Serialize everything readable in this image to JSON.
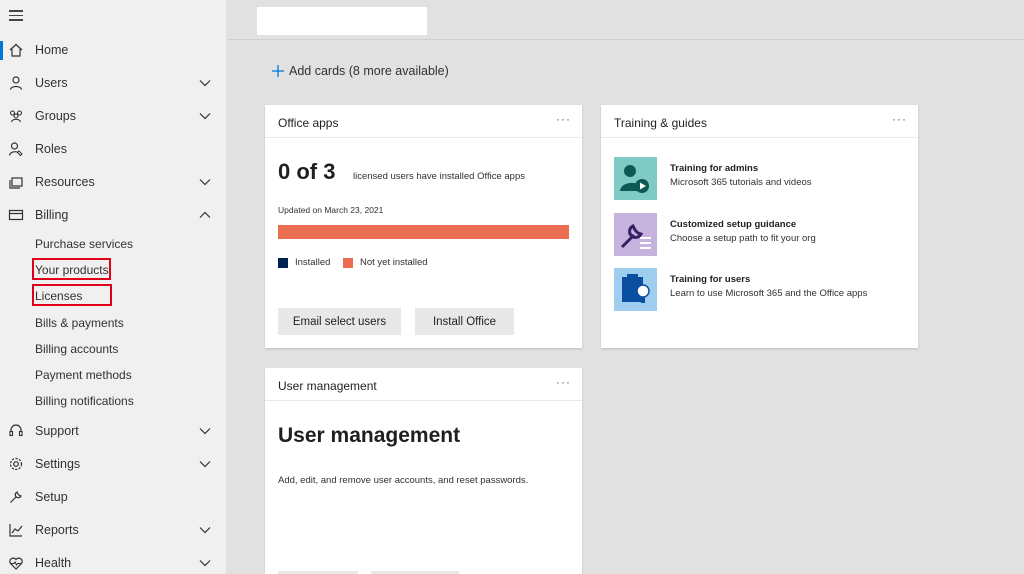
{
  "sidebar": {
    "menu_icon": "hamburger-icon",
    "items": [
      {
        "label": "Home",
        "icon": "home-icon",
        "expanded": null
      },
      {
        "label": "Users",
        "icon": "person-icon",
        "expanded": false
      },
      {
        "label": "Groups",
        "icon": "groups-icon",
        "expanded": false
      },
      {
        "label": "Roles",
        "icon": "roles-icon",
        "expanded": null
      },
      {
        "label": "Resources",
        "icon": "resources-icon",
        "expanded": false
      },
      {
        "label": "Billing",
        "icon": "billing-icon",
        "expanded": true
      },
      {
        "label": "Support",
        "icon": "headset-icon",
        "expanded": false
      },
      {
        "label": "Settings",
        "icon": "gear-icon",
        "expanded": false
      },
      {
        "label": "Setup",
        "icon": "wrench-icon",
        "expanded": null
      },
      {
        "label": "Reports",
        "icon": "chart-icon",
        "expanded": false
      },
      {
        "label": "Health",
        "icon": "heart-icon",
        "expanded": false
      }
    ],
    "billing_sub": [
      "Purchase services",
      "Your products",
      "Licenses",
      "Bills & payments",
      "Billing accounts",
      "Payment methods",
      "Billing notifications"
    ],
    "highlighted_sub": [
      "Your products",
      "Licenses"
    ],
    "active": "Home"
  },
  "main": {
    "add_cards_label": "Add cards (8 more available)",
    "colors": {
      "accent": "#0078d4",
      "highlight": "#e0001b",
      "installed": "#002050",
      "not_installed": "#eb6e52"
    },
    "office_apps": {
      "title": "Office apps",
      "more": "···",
      "stat": "0 of 3",
      "stat_desc": "licensed users have installed Office apps",
      "updated": "Updated on March 23, 2021",
      "installed_fraction": 0,
      "legend_installed": "Installed",
      "legend_not_installed": "Not yet installed",
      "btn_email": "Email select users",
      "btn_install": "Install Office"
    },
    "training": {
      "title": "Training & guides",
      "more": "···",
      "items": [
        {
          "title": "Training for admins",
          "desc": "Microsoft 365 tutorials and videos",
          "icon": "admin-video-icon"
        },
        {
          "title": "Customized setup guidance",
          "desc": "Choose a setup path to fit your org",
          "icon": "setup-tools-icon"
        },
        {
          "title": "Training for users",
          "desc": "Learn to use Microsoft 365 and the Office apps",
          "icon": "clipboard-bulb-icon"
        }
      ]
    },
    "user_mgmt": {
      "title": "User management",
      "more": "···",
      "heading": "User management",
      "desc": "Add, edit, and remove user accounts, and reset passwords."
    }
  }
}
